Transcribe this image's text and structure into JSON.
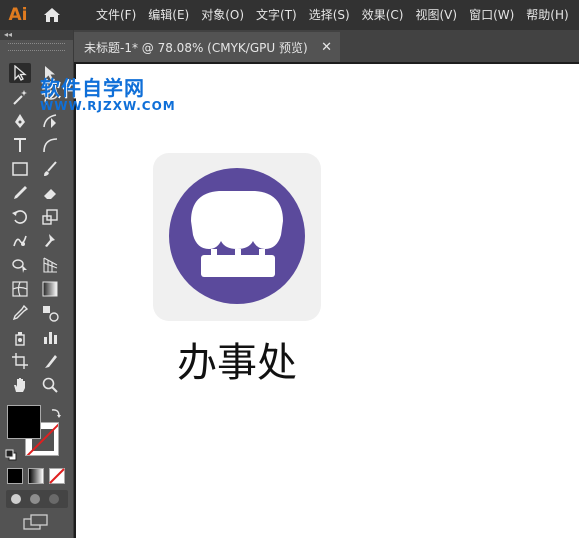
{
  "app": {
    "logo_text": "Ai"
  },
  "menu": [
    "文件(F)",
    "编辑(E)",
    "对象(O)",
    "文字(T)",
    "选择(S)",
    "效果(C)",
    "视图(V)",
    "窗口(W)",
    "帮助(H)"
  ],
  "document_tab": {
    "title": "未标题-1* @ 78.08% (CMYK/GPU 预览)",
    "close_label": "✕"
  },
  "toolbar": {
    "collapse_label": "◂◂"
  },
  "watermark": {
    "title": "软件自学网",
    "url": "WWW.RJZXW.COM"
  },
  "artboard": {
    "icon_caption": "办事处"
  },
  "colors": {
    "icon_circle": "#5b4a9c",
    "accent": "#e07b1f",
    "watermark": "#0f6fd8"
  },
  "icons": [
    "home-icon",
    "selection-tool-icon",
    "direct-selection-tool-icon",
    "magic-wand-icon",
    "lasso-icon",
    "pen-tool-icon",
    "curvature-icon",
    "type-tool-icon",
    "arc-icon",
    "rectangle-icon",
    "paintbrush-icon",
    "pencil-icon",
    "eraser-icon",
    "rotate-icon",
    "scale-icon",
    "warp-icon",
    "puppet-warp-icon",
    "shape-builder-icon",
    "perspective-grid-icon",
    "mesh-icon",
    "gradient-icon",
    "eyedropper-icon",
    "blend-icon",
    "symbol-sprayer-icon",
    "column-graph-icon",
    "artboard-tool-icon",
    "slice-icon",
    "hand-icon",
    "zoom-icon"
  ]
}
